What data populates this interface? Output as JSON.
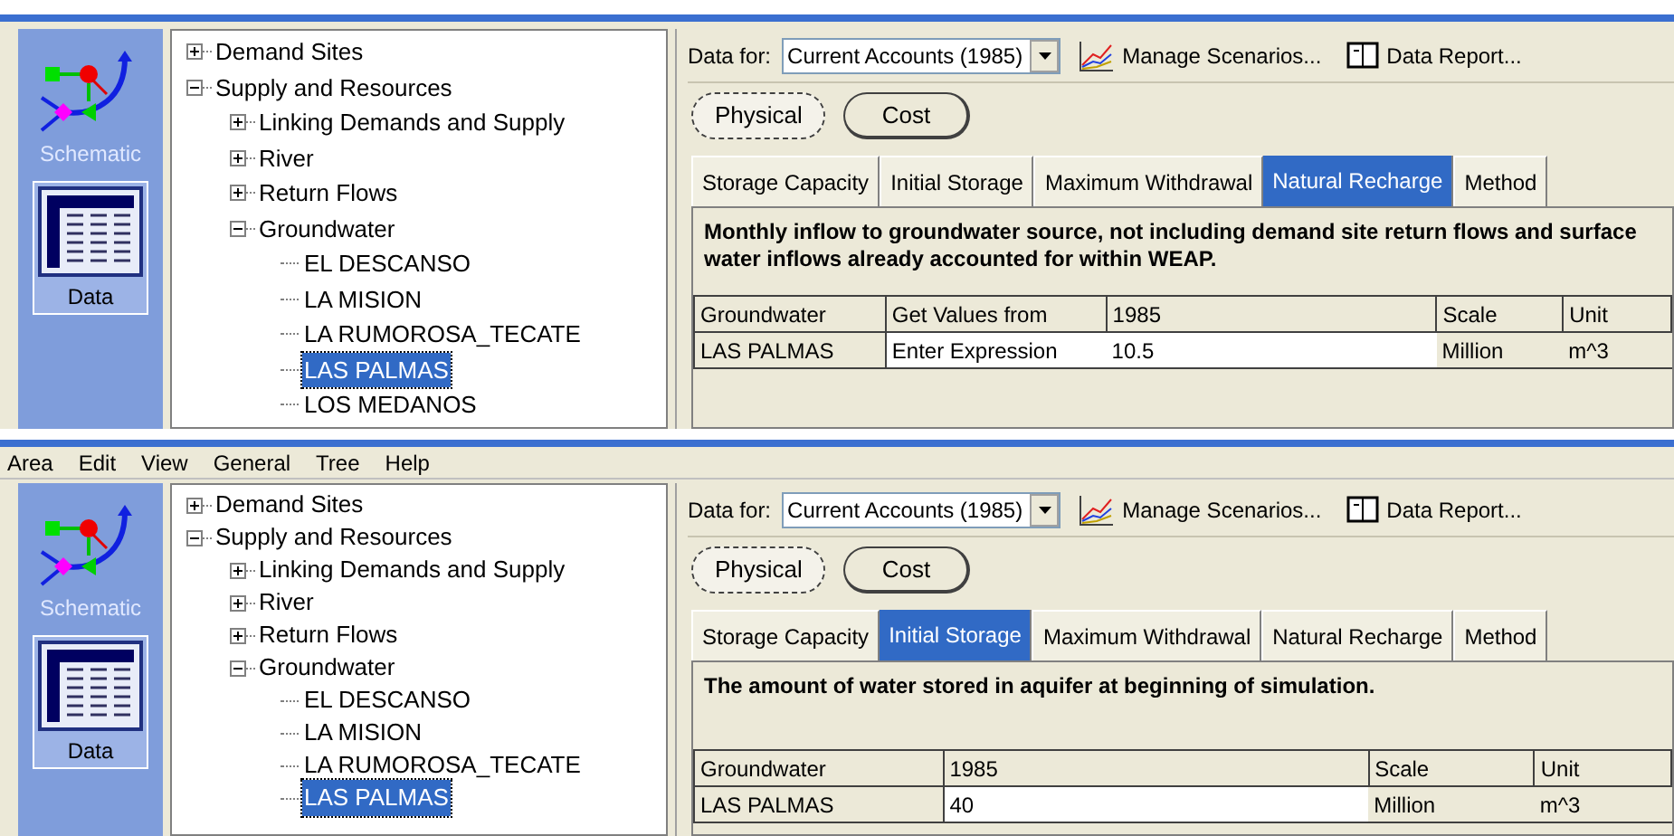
{
  "panels": [
    {
      "sidebar": [
        {
          "kind": "schematic",
          "label": "Schematic",
          "selected": false
        },
        {
          "kind": "data",
          "label": "Data",
          "selected": true
        }
      ],
      "tree": [
        {
          "label": "Demand Sites",
          "expanded": false
        },
        {
          "label": "Supply and Resources",
          "expanded": true,
          "children": [
            {
              "label": "Linking Demands and Supply",
              "expanded": false
            },
            {
              "label": "River",
              "expanded": false
            },
            {
              "label": "Return Flows",
              "expanded": false
            },
            {
              "label": "Groundwater",
              "expanded": true,
              "children": [
                {
                  "label": "EL DESCANSO",
                  "selected": false
                },
                {
                  "label": "LA MISION",
                  "selected": false
                },
                {
                  "label": "LA RUMOROSA_TECATE",
                  "selected": false
                },
                {
                  "label": "LAS PALMAS",
                  "selected": true
                },
                {
                  "label": "LOS MEDANOS",
                  "selected": false
                }
              ]
            }
          ]
        }
      ],
      "data_for_label": "Data for:",
      "data_for_value": "Current Accounts (1985)",
      "manage_scenarios": "Manage Scenarios...",
      "data_report": "Data Report...",
      "modes": [
        {
          "label": "Physical",
          "selected": true
        },
        {
          "label": "Cost",
          "selected": false
        }
      ],
      "tabs": [
        {
          "label": "Storage Capacity",
          "selected": false
        },
        {
          "label": "Initial Storage",
          "selected": false
        },
        {
          "label": "Maximum Withdrawal",
          "selected": false
        },
        {
          "label": "Natural Recharge",
          "selected": true
        },
        {
          "label": "Method",
          "selected": false
        }
      ],
      "description": "Monthly inflow to groundwater source, not including demand site return flows and surface water inflows already accounted for within WEAP.",
      "table": {
        "columns": [
          "Groundwater",
          "Get Values from",
          "1985",
          "Scale",
          "Unit"
        ],
        "rows": [
          [
            "LAS PALMAS",
            "Enter Expression",
            "10.5",
            "Million",
            "m^3"
          ]
        ]
      }
    },
    {
      "menu": [
        "Area",
        "Edit",
        "View",
        "General",
        "Tree",
        "Help"
      ],
      "sidebar": [
        {
          "kind": "schematic",
          "label": "Schematic",
          "selected": false
        },
        {
          "kind": "data",
          "label": "Data",
          "selected": true
        }
      ],
      "tree": [
        {
          "label": "Demand Sites",
          "expanded": false
        },
        {
          "label": "Supply and Resources",
          "expanded": true,
          "children": [
            {
              "label": "Linking Demands and Supply",
              "expanded": false
            },
            {
              "label": "River",
              "expanded": false
            },
            {
              "label": "Return Flows",
              "expanded": false
            },
            {
              "label": "Groundwater",
              "expanded": true,
              "children": [
                {
                  "label": "EL DESCANSO",
                  "selected": false
                },
                {
                  "label": "LA MISION",
                  "selected": false
                },
                {
                  "label": "LA RUMOROSA_TECATE",
                  "selected": false
                },
                {
                  "label": "LAS PALMAS",
                  "selected": true
                }
              ]
            }
          ]
        }
      ],
      "data_for_label": "Data for:",
      "data_for_value": "Current Accounts (1985)",
      "manage_scenarios": "Manage Scenarios...",
      "data_report": "Data Report...",
      "modes": [
        {
          "label": "Physical",
          "selected": true
        },
        {
          "label": "Cost",
          "selected": false
        }
      ],
      "tabs": [
        {
          "label": "Storage Capacity",
          "selected": false
        },
        {
          "label": "Initial Storage",
          "selected": true
        },
        {
          "label": "Maximum Withdrawal",
          "selected": false
        },
        {
          "label": "Natural Recharge",
          "selected": false
        },
        {
          "label": "Method",
          "selected": false
        }
      ],
      "description": "The amount of water stored in aquifer at beginning of simulation.",
      "table": {
        "columns": [
          "Groundwater",
          "1985",
          "Scale",
          "Unit"
        ],
        "rows": [
          [
            "LAS PALMAS",
            "40",
            "Million",
            "m^3"
          ]
        ]
      }
    }
  ]
}
